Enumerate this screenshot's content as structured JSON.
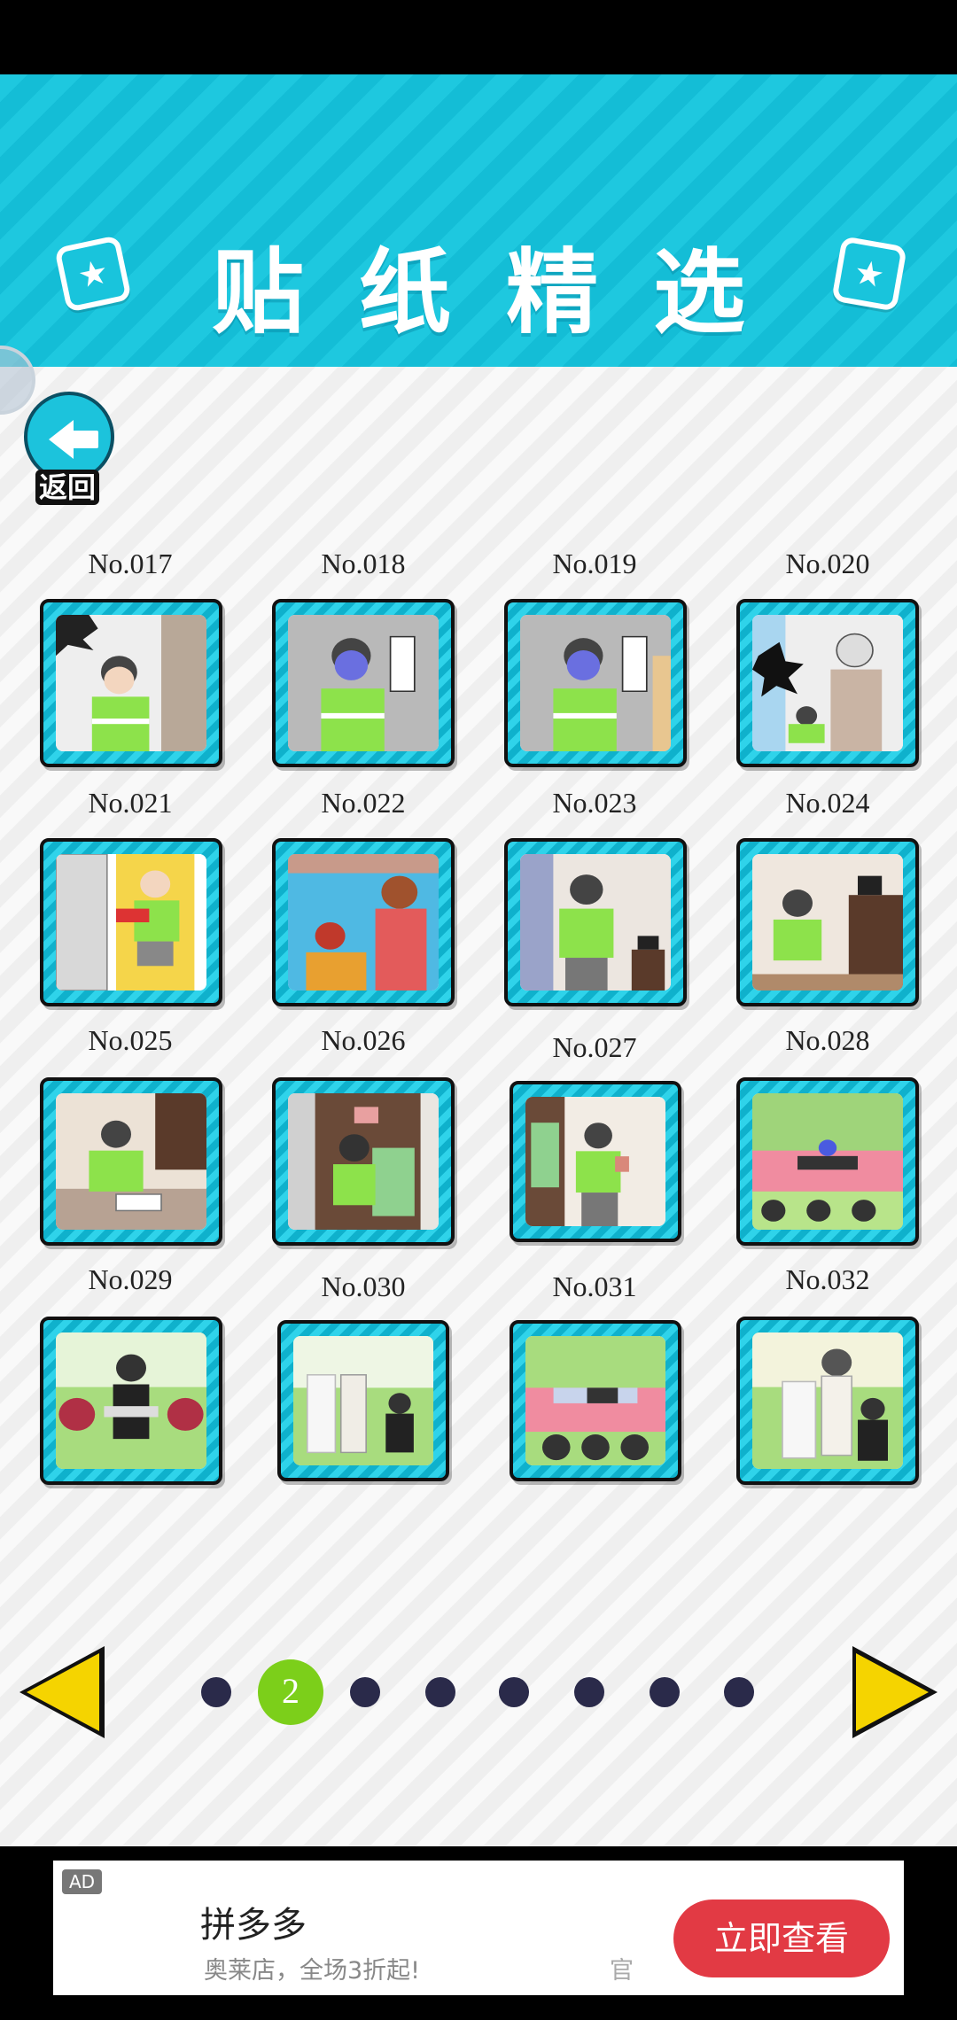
{
  "header": {
    "title": "贴纸精选",
    "deco_symbol": "★"
  },
  "back_button": {
    "label": "返回"
  },
  "stickers": [
    {
      "label": "No.017"
    },
    {
      "label": "No.018"
    },
    {
      "label": "No.019"
    },
    {
      "label": "No.020"
    },
    {
      "label": "No.021"
    },
    {
      "label": "No.022"
    },
    {
      "label": "No.023"
    },
    {
      "label": "No.024"
    },
    {
      "label": "No.025"
    },
    {
      "label": "No.026"
    },
    {
      "label": "No.027"
    },
    {
      "label": "No.028"
    },
    {
      "label": "No.029"
    },
    {
      "label": "No.030"
    },
    {
      "label": "No.031"
    },
    {
      "label": "No.032"
    }
  ],
  "pager": {
    "current_page": "2",
    "total_dots": 8
  },
  "ad": {
    "tag": "AD",
    "title": "拼多多",
    "subtitle": "奥莱店，全场3折起!",
    "subtitle_extra": "官",
    "cta": "立即查看"
  },
  "colors": {
    "header_bg": "#1ec8df",
    "frame_cyan": "#2fd3ea",
    "active_dot": "#7ccf1a",
    "arrow_yellow": "#f5d400",
    "cta_red": "#e23a44"
  }
}
